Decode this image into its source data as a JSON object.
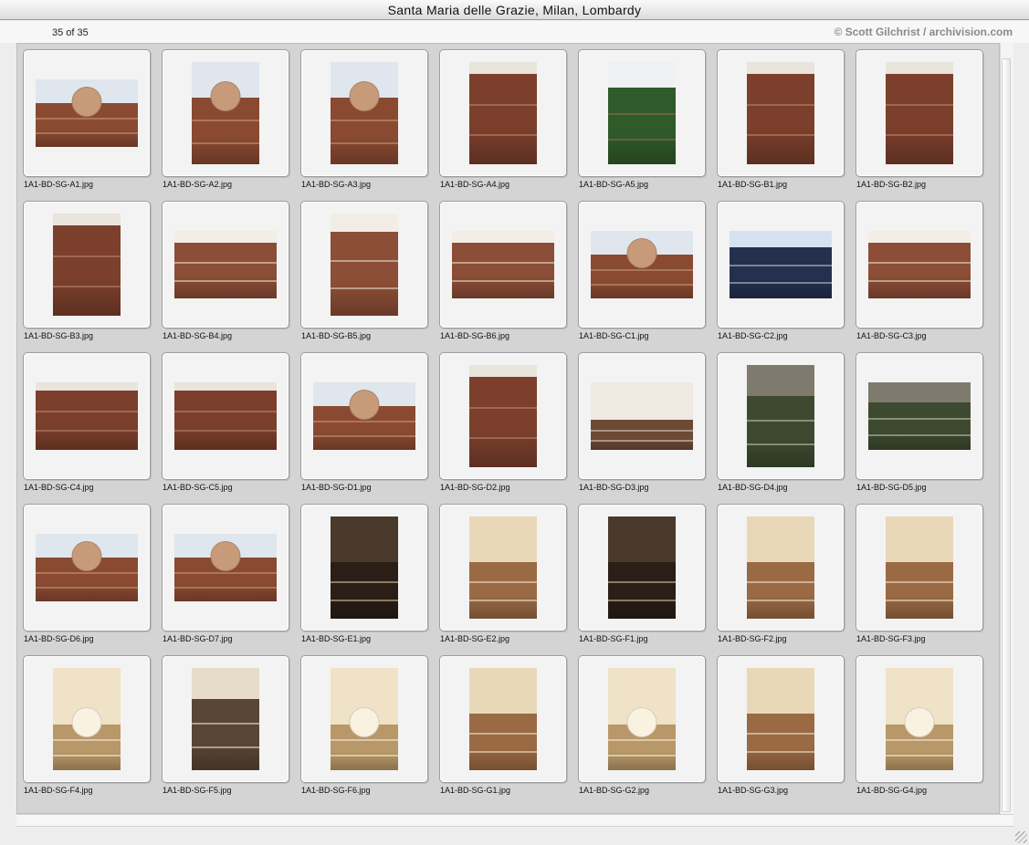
{
  "window": {
    "title": "Santa Maria delle Grazie, Milan, Lombardy"
  },
  "info": {
    "counter": "35 of 35",
    "credit": "© Scott Gilchrist / archivision.com"
  },
  "thumbnails": [
    {
      "filename": "1A1-BD-SG-A1.jpg",
      "orientation": "landscape",
      "palette": "exterior-sky"
    },
    {
      "filename": "1A1-BD-SG-A2.jpg",
      "orientation": "portrait",
      "palette": "exterior-sky"
    },
    {
      "filename": "1A1-BD-SG-A3.jpg",
      "orientation": "portrait",
      "palette": "exterior-sky"
    },
    {
      "filename": "1A1-BD-SG-A4.jpg",
      "orientation": "portrait",
      "palette": "exterior-brick"
    },
    {
      "filename": "1A1-BD-SG-A5.jpg",
      "orientation": "portrait",
      "palette": "exterior-garden"
    },
    {
      "filename": "1A1-BD-SG-B1.jpg",
      "orientation": "portrait",
      "palette": "exterior-brick"
    },
    {
      "filename": "1A1-BD-SG-B2.jpg",
      "orientation": "portrait",
      "palette": "exterior-brick"
    },
    {
      "filename": "1A1-BD-SG-B3.jpg",
      "orientation": "portrait",
      "palette": "exterior-brick"
    },
    {
      "filename": "1A1-BD-SG-B4.jpg",
      "orientation": "landscape",
      "palette": "exterior-drum"
    },
    {
      "filename": "1A1-BD-SG-B5.jpg",
      "orientation": "portrait",
      "palette": "exterior-drum"
    },
    {
      "filename": "1A1-BD-SG-B6.jpg",
      "orientation": "landscape",
      "palette": "exterior-drum"
    },
    {
      "filename": "1A1-BD-SG-C1.jpg",
      "orientation": "landscape",
      "palette": "exterior-sky"
    },
    {
      "filename": "1A1-BD-SG-C2.jpg",
      "orientation": "landscape",
      "palette": "exterior-blue"
    },
    {
      "filename": "1A1-BD-SG-C3.jpg",
      "orientation": "landscape",
      "palette": "exterior-drum"
    },
    {
      "filename": "1A1-BD-SG-C4.jpg",
      "orientation": "landscape",
      "palette": "exterior-brick"
    },
    {
      "filename": "1A1-BD-SG-C5.jpg",
      "orientation": "landscape",
      "palette": "exterior-brick"
    },
    {
      "filename": "1A1-BD-SG-D1.jpg",
      "orientation": "landscape",
      "palette": "exterior-sky"
    },
    {
      "filename": "1A1-BD-SG-D2.jpg",
      "orientation": "portrait",
      "palette": "exterior-brick"
    },
    {
      "filename": "1A1-BD-SG-D3.jpg",
      "orientation": "landscape",
      "palette": "exterior-wall"
    },
    {
      "filename": "1A1-BD-SG-D4.jpg",
      "orientation": "portrait",
      "palette": "cloister"
    },
    {
      "filename": "1A1-BD-SG-D5.jpg",
      "orientation": "landscape",
      "palette": "cloister"
    },
    {
      "filename": "1A1-BD-SG-D6.jpg",
      "orientation": "landscape",
      "palette": "exterior-sky"
    },
    {
      "filename": "1A1-BD-SG-D7.jpg",
      "orientation": "landscape",
      "palette": "exterior-sky"
    },
    {
      "filename": "1A1-BD-SG-E1.jpg",
      "orientation": "portrait",
      "palette": "interior-dark"
    },
    {
      "filename": "1A1-BD-SG-E2.jpg",
      "orientation": "portrait",
      "palette": "interior-warm"
    },
    {
      "filename": "1A1-BD-SG-F1.jpg",
      "orientation": "portrait",
      "palette": "interior-dark"
    },
    {
      "filename": "1A1-BD-SG-F2.jpg",
      "orientation": "portrait",
      "palette": "interior-warm"
    },
    {
      "filename": "1A1-BD-SG-F3.jpg",
      "orientation": "portrait",
      "palette": "interior-warm"
    },
    {
      "filename": "1A1-BD-SG-F4.jpg",
      "orientation": "portrait",
      "palette": "interior-dome"
    },
    {
      "filename": "1A1-BD-SG-F5.jpg",
      "orientation": "portrait",
      "palette": "interior-stone"
    },
    {
      "filename": "1A1-BD-SG-F6.jpg",
      "orientation": "portrait",
      "palette": "interior-dome"
    },
    {
      "filename": "1A1-BD-SG-G1.jpg",
      "orientation": "portrait",
      "palette": "interior-warm"
    },
    {
      "filename": "1A1-BD-SG-G2.jpg",
      "orientation": "portrait",
      "palette": "interior-dome"
    },
    {
      "filename": "1A1-BD-SG-G3.jpg",
      "orientation": "portrait",
      "palette": "interior-warm"
    },
    {
      "filename": "1A1-BD-SG-G4.jpg",
      "orientation": "portrait",
      "palette": "interior-dome"
    }
  ]
}
